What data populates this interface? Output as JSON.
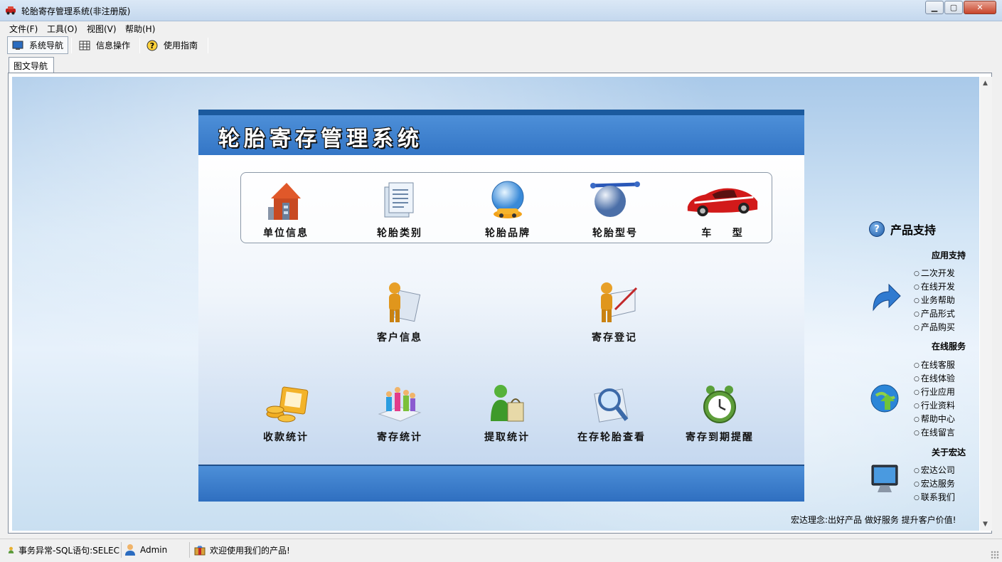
{
  "window": {
    "title": "轮胎寄存管理系统(非注册版)"
  },
  "menu": [
    {
      "label": "文件(F)"
    },
    {
      "label": "工具(O)"
    },
    {
      "label": "视图(V)"
    },
    {
      "label": "帮助(H)"
    }
  ],
  "toolbar": [
    {
      "label": "系统导航",
      "active": true
    },
    {
      "label": "信息操作"
    },
    {
      "label": "使用指南"
    }
  ],
  "tab": {
    "label": "图文导航"
  },
  "panel": {
    "title": "轮胎寄存管理系统"
  },
  "catalog": [
    {
      "label": "单位信息"
    },
    {
      "label": "轮胎类别"
    },
    {
      "label": "轮胎品牌"
    },
    {
      "label": "轮胎型号"
    },
    {
      "label": "车    型"
    }
  ],
  "business": [
    {
      "label": "客户信息"
    },
    {
      "label": "寄存登记"
    }
  ],
  "stats": [
    {
      "label": "收款统计"
    },
    {
      "label": "寄存统计"
    },
    {
      "label": "提取统计"
    },
    {
      "label": "在存轮胎查看"
    },
    {
      "label": "寄存到期提醒"
    }
  ],
  "support": {
    "title": "产品支持",
    "groups": [
      {
        "heading": "应用支持",
        "links": [
          "二次开发",
          "在线开发",
          "业务帮助",
          "产品形式",
          "产品购买"
        ]
      },
      {
        "heading": "在线服务",
        "links": [
          "在线客服",
          "在线体验",
          "行业应用",
          "行业资料",
          "帮助中心",
          "在线留言"
        ]
      },
      {
        "heading": "关于宏达",
        "links": [
          "宏达公司",
          "宏达服务",
          "联系我们"
        ]
      }
    ],
    "motto": "宏达理念:出好产品 做好服务 提升客户价值!"
  },
  "status": {
    "error": "事务异常-SQL语句:SELEC",
    "user": "Admin",
    "welcome": "欢迎使用我们的产品!"
  },
  "colors": {
    "header_blue": "#3b7dcc",
    "band_navy": "#1b5a9e",
    "bg_sky": "#c9dff1"
  }
}
